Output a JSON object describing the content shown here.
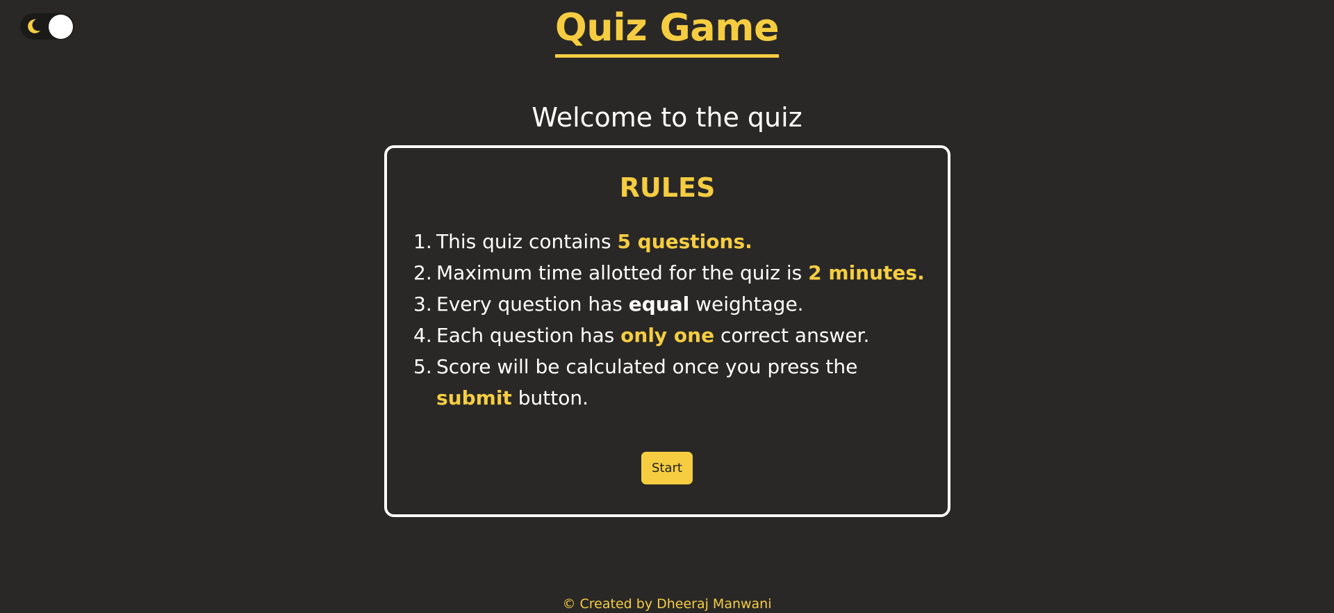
{
  "theme_toggle": {
    "icon": "moon-icon",
    "state": "dark"
  },
  "header": {
    "title": "Quiz Game"
  },
  "welcome": {
    "text": "Welcome to the quiz"
  },
  "rules": {
    "heading": "RULES",
    "items": [
      {
        "number": "1.",
        "parts": [
          {
            "text": "This quiz contains ",
            "style": "normal"
          },
          {
            "text": "5 questions.",
            "style": "highlight"
          }
        ]
      },
      {
        "number": "2.",
        "parts": [
          {
            "text": "Maximum time allotted for the quiz is ",
            "style": "normal"
          },
          {
            "text": "2 minutes.",
            "style": "highlight"
          }
        ]
      },
      {
        "number": "3.",
        "parts": [
          {
            "text": "Every question has ",
            "style": "normal"
          },
          {
            "text": "equal",
            "style": "bold"
          },
          {
            "text": " weightage.",
            "style": "normal"
          }
        ]
      },
      {
        "number": "4.",
        "parts": [
          {
            "text": "Each question has ",
            "style": "normal"
          },
          {
            "text": "only one",
            "style": "highlight"
          },
          {
            "text": " correct answer.",
            "style": "normal"
          }
        ]
      },
      {
        "number": "5.",
        "parts": [
          {
            "text": "Score will be calculated once you press the ",
            "style": "normal"
          },
          {
            "text": "submit",
            "style": "highlight"
          },
          {
            "text": " button.",
            "style": "normal"
          }
        ]
      }
    ],
    "start_label": "Start"
  },
  "footer": {
    "text": "© Created by Dheeraj Manwani"
  },
  "colors": {
    "background": "#292827",
    "accent": "#f6cd41",
    "text": "#ffffff"
  }
}
